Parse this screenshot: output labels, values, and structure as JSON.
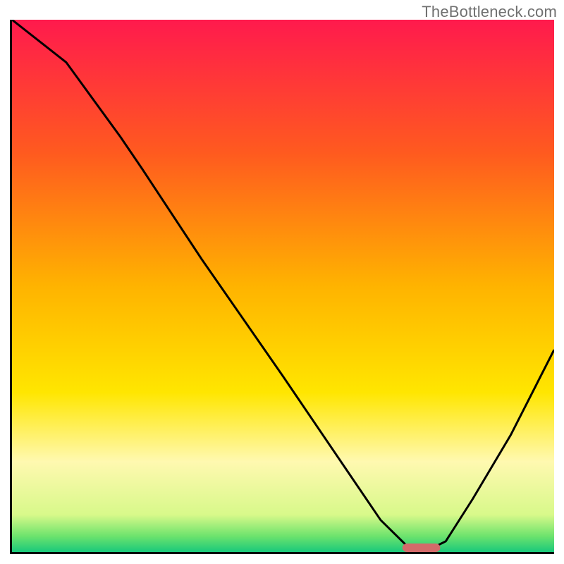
{
  "watermark": "TheBottleneck.com",
  "chart_data": {
    "type": "line",
    "title": "",
    "xlabel": "",
    "ylabel": "",
    "xlim": [
      0,
      100
    ],
    "ylim": [
      0,
      100
    ],
    "gradient_stops": [
      {
        "y": 0,
        "color": "#ff1a4d"
      },
      {
        "y": 25,
        "color": "#ff5a1f"
      },
      {
        "y": 50,
        "color": "#ffb300"
      },
      {
        "y": 70,
        "color": "#ffe600"
      },
      {
        "y": 83,
        "color": "#fff9b0"
      },
      {
        "y": 93,
        "color": "#d8f98a"
      },
      {
        "y": 97,
        "color": "#6de36d"
      },
      {
        "y": 100,
        "color": "#19c97b"
      }
    ],
    "series": [
      {
        "name": "bottleneck-curve",
        "color": "#000000",
        "x": [
          0,
          10,
          20,
          24,
          35,
          50,
          62,
          68,
          73,
          78,
          80,
          85,
          92,
          100
        ],
        "y": [
          100,
          92,
          78,
          72,
          55,
          33,
          15,
          6,
          1,
          1,
          2,
          10,
          22,
          38
        ]
      }
    ],
    "marker": {
      "name": "optimal-range-pill",
      "x_center": 75.5,
      "y": 0.8,
      "width": 7,
      "height": 1.6,
      "color": "#d46a6a"
    }
  }
}
